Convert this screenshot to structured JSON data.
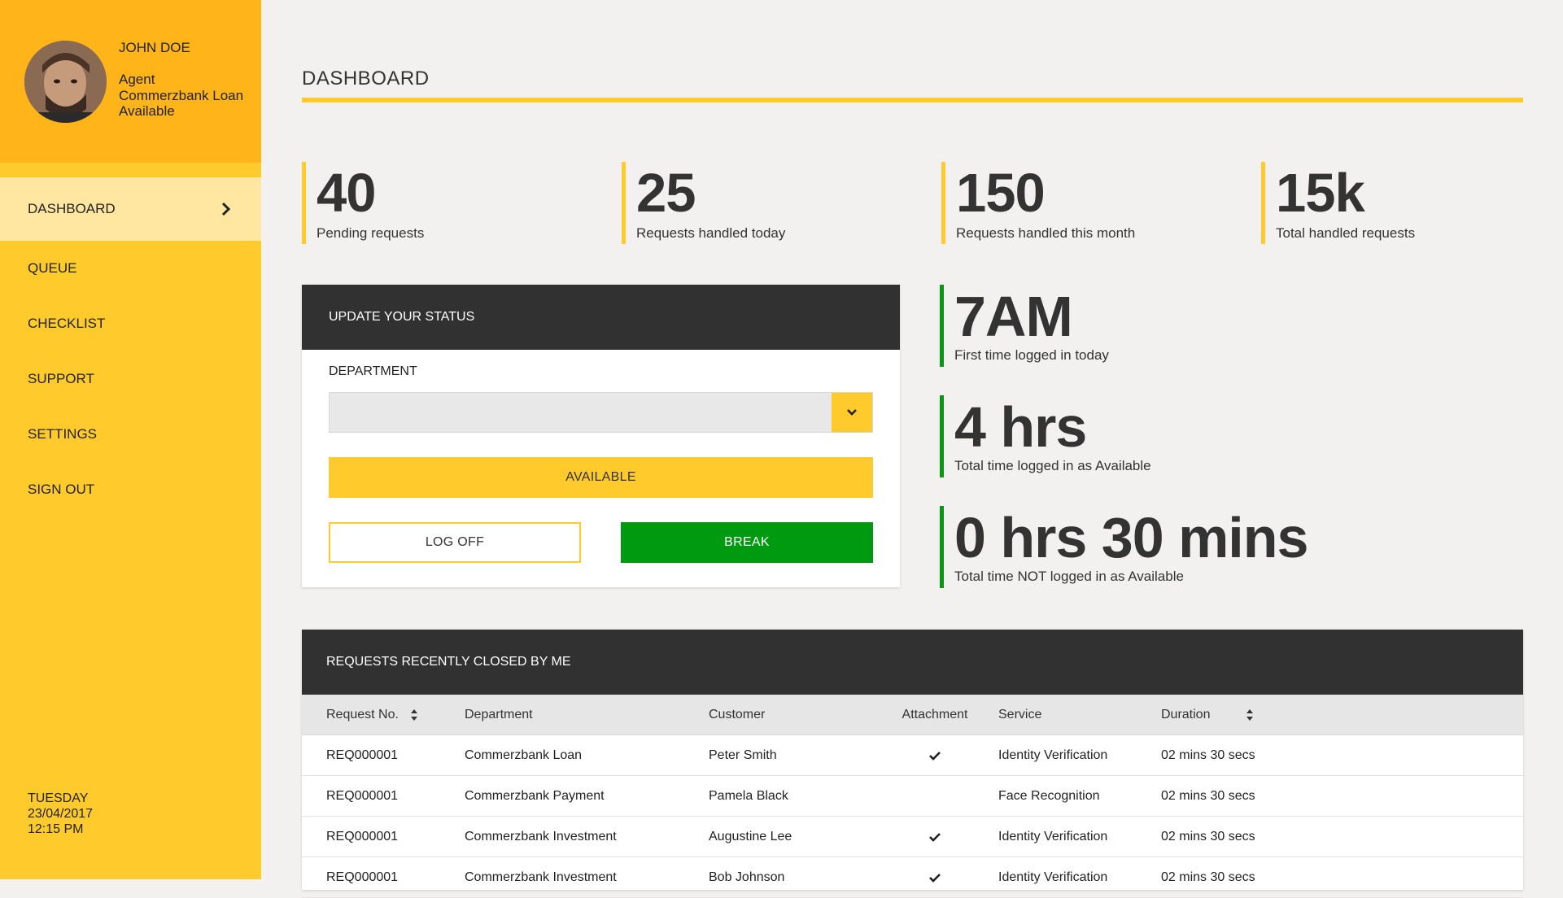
{
  "profile": {
    "name": "JOHN DOE",
    "role": "Agent",
    "department": "Commerzbank Loan",
    "status": "Available"
  },
  "nav": {
    "items": [
      {
        "label": "DASHBOARD",
        "active": true
      },
      {
        "label": "QUEUE"
      },
      {
        "label": "CHECKLIST"
      },
      {
        "label": "SUPPORT"
      },
      {
        "label": "SETTINGS"
      },
      {
        "label": "SIGN OUT"
      }
    ]
  },
  "sidebar_footer": {
    "day": "TUESDAY",
    "date": "23/04/2017",
    "time": "12:15 PM"
  },
  "page": {
    "title": "DASHBOARD"
  },
  "stats": [
    {
      "value": "40",
      "label": "Pending requests"
    },
    {
      "value": "25",
      "label": "Requests handled today"
    },
    {
      "value": "150",
      "label": "Requests handled this month"
    },
    {
      "value": "15k",
      "label": "Total handled requests"
    }
  ],
  "time_stats": [
    {
      "value": "7AM",
      "label": "First time logged in today"
    },
    {
      "value": "4 hrs",
      "label": "Total time logged in as Available"
    },
    {
      "value": "0 hrs 30 mins",
      "label": "Total time NOT logged in as Available"
    }
  ],
  "status_card": {
    "title": "UPDATE YOUR STATUS",
    "department_label": "DEPARTMENT",
    "department_value": "",
    "available_label": "AVAILABLE",
    "logoff_label": "LOG OFF",
    "break_label": "BREAK"
  },
  "requests": {
    "title": "REQUESTS RECENTLY CLOSED BY ME",
    "columns": [
      "Request No.",
      "Department",
      "Customer",
      "Attachment",
      "Service",
      "Duration"
    ],
    "rows": [
      {
        "request_no": "REQ000001",
        "department": "Commerzbank Loan",
        "customer": "Peter Smith",
        "attachment": true,
        "service": "Identity Verification",
        "duration": "02 mins 30 secs"
      },
      {
        "request_no": "REQ000001",
        "department": "Commerzbank Payment",
        "customer": "Pamela Black",
        "attachment": false,
        "service": "Face Recognition",
        "duration": "02 mins 30 secs"
      },
      {
        "request_no": "REQ000001",
        "department": "Commerzbank Investment",
        "customer": "Augustine Lee",
        "attachment": true,
        "service": "Identity Verification",
        "duration": "02 mins 30 secs"
      },
      {
        "request_no": "REQ000001",
        "department": "Commerzbank Investment",
        "customer": "Bob Johnson",
        "attachment": true,
        "service": "Identity Verification",
        "duration": "02 mins 30 secs"
      }
    ]
  },
  "colors": {
    "sidebar": "#ffca2c",
    "profile_bg": "#ffb519",
    "active_nav": "#ffe7a1",
    "accent_yellow": "#ffca2c",
    "accent_green": "#089811",
    "card_header": "#313131"
  }
}
